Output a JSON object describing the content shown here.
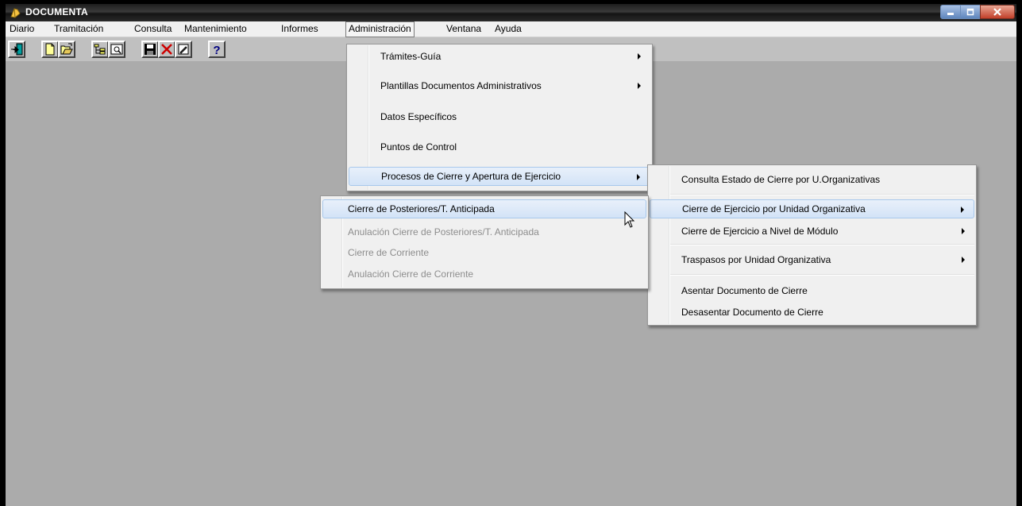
{
  "window": {
    "title": "DOCUMENTA"
  },
  "menubar": {
    "items": [
      "Diario",
      "Tramitación",
      "Consulta",
      "Mantenimiento",
      "Informes",
      "Administración",
      "Ventana",
      "Ayuda"
    ],
    "open_item": "Administración"
  },
  "toolbar": {
    "buttons": [
      "exit-icon",
      "new-document-icon",
      "open-folder-icon",
      "tree-view-icon",
      "view-icon",
      "save-icon",
      "delete-icon",
      "edit-icon",
      "help-icon"
    ]
  },
  "admin_menu": {
    "items": [
      {
        "label": "Trámites-Guía",
        "submenu": true
      },
      {
        "label": "Plantillas Documentos Administrativos",
        "submenu": true
      },
      {
        "label": "Datos Específicos",
        "submenu": false
      },
      {
        "label": "Puntos de Control",
        "submenu": false
      },
      {
        "label": "Procesos de Cierre y Apertura de Ejercicio",
        "submenu": true,
        "highlighted": true
      }
    ]
  },
  "cierre_menu": {
    "items": [
      {
        "label": "Consulta Estado de Cierre por U.Organizativas",
        "submenu": false
      },
      {
        "label": "Cierre de Ejercicio por Unidad Organizativa",
        "submenu": true,
        "highlighted": true
      },
      {
        "label": "Cierre de Ejercicio a  Nivel de  Módulo",
        "submenu": true
      },
      {
        "label": "Traspasos por Unidad Organizativa",
        "submenu": true
      },
      {
        "label": "Asentar Documento de Cierre",
        "submenu": false
      },
      {
        "label": "Desasentar Documento de Cierre",
        "submenu": false
      }
    ]
  },
  "unidad_menu": {
    "items": [
      {
        "label": "Cierre de Posteriores/T. Anticipada",
        "enabled": true,
        "highlighted": true
      },
      {
        "label": "Anulación Cierre de Posteriores/T. Anticipada",
        "enabled": false
      },
      {
        "label": "Cierre de Corriente",
        "enabled": false
      },
      {
        "label": "Anulación Cierre de Corriente",
        "enabled": false
      }
    ]
  }
}
